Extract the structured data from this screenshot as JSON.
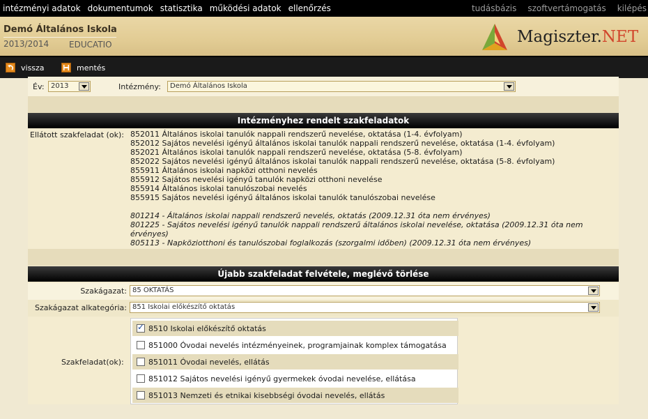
{
  "topnav": [
    "intézményi adatok",
    "dokumentumok",
    "statisztika",
    "működési adatok",
    "ellenőrzés"
  ],
  "toplinks": [
    "tudásbázis",
    "szoftvertámogatás",
    "kilépés"
  ],
  "header": {
    "school": "Demó Általános Iskola",
    "year": "2013/2014",
    "educatio": "EDUCATIO",
    "logo_main": "Magiszter.",
    "logo_net": "NET"
  },
  "toolbar": {
    "back": "vissza",
    "save": "mentés"
  },
  "filters": {
    "year_label": "Év:",
    "year_value": "2013",
    "institution_label": "Intézmény:",
    "institution_value": "Demó Általános Iskola"
  },
  "section1": {
    "title": "Intézményhez rendelt szakfeladatok",
    "label": "Ellátott szakfeladat (ok):",
    "codes": [
      "852011 Általános iskolai tanulók nappali rendszerű nevelése, oktatása (1-4. évfolyam)",
      "852012 Sajátos nevelési igényű általános iskolai tanulók nappali rendszerű nevelése, oktatása (1-4. évfolyam)",
      "852021 Általános iskolai tanulók nappali rendszerű nevelése, oktatása (5-8. évfolyam)",
      "852022 Sajátos nevelési igényű általános iskolai tanulók nappali rendszerű nevelése, oktatása (5-8. évfolyam)",
      "855911 Általános iskolai napközi otthoni nevelés",
      "855912 Sajátos nevelési igényű tanulók napközi otthoni nevelése",
      "855914 Általános iskolai tanulószobai nevelés",
      "855915 Sajátos nevelési igényű általános iskolai tanulók tanulószobai nevelése"
    ],
    "invalid_codes": [
      "801214 - Általános iskolai nappali rendszerű nevelés, oktatás (2009.12.31 óta nem érvényes)",
      "801225 - Sajátos nevelési igényű tanulók nappali rendszerű általános iskolai nevelése, oktatása (2009.12.31 óta nem érvényes)",
      "805113 - Napköziotthoni és tanulószobai foglalkozás (szorgalmi időben) (2009.12.31 óta nem érvényes)"
    ]
  },
  "section2": {
    "title": "Újabb szakfeladat felvétele, meglévő törlése",
    "branch_label": "Szakágazat:",
    "branch_value": "85 OKTATÁS",
    "subcat_label": "Szakágazat alkategória:",
    "subcat_value": "851 Iskolai előkészítő oktatás",
    "tasks_label": "Szakfeladat(ok):",
    "tasks": [
      {
        "label": "8510 Iskolai előkészítő oktatás",
        "checked": true
      },
      {
        "label": "851000 Óvodai nevelés intézményeinek, programjainak komplex támogatása",
        "checked": false
      },
      {
        "label": "851011 Óvodai nevelés, ellátás",
        "checked": false
      },
      {
        "label": "851012 Sajátos nevelési igényű gyermekek óvodai nevelése, ellátása",
        "checked": false
      },
      {
        "label": "851013 Nemzeti és etnikai kisebbségi óvodai nevelés, ellátás",
        "checked": false
      }
    ]
  }
}
